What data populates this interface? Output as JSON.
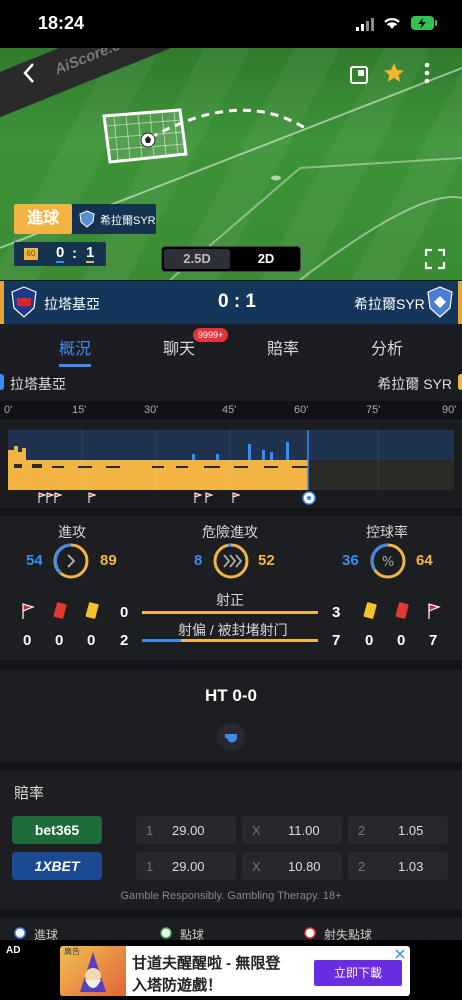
{
  "status": {
    "time": "18:24"
  },
  "pitch": {
    "brand_text": "AiScore.com",
    "event_label": "進球",
    "event_team": "希拉爾SYR",
    "live_minute": "60",
    "live_score_home": "0",
    "live_score_sep": ":",
    "live_score_away": "1",
    "view_25d": "2.5D",
    "view_2d": "2D"
  },
  "match": {
    "home_team": "拉塔基亞",
    "away_team": "希拉爾SYR",
    "score": "0 : 1"
  },
  "tabs": [
    {
      "label": "概況",
      "active": true
    },
    {
      "label": "聊天",
      "badge": "9999+"
    },
    {
      "label": "賠率"
    },
    {
      "label": "分析"
    }
  ],
  "timeline": {
    "home": "拉塔基亞",
    "away": "希拉爾 SYR",
    "ticks": [
      "0'",
      "15'",
      "30'",
      "45'",
      "60'",
      "75'",
      "90'"
    ]
  },
  "stats": {
    "attack": {
      "label": "進攻",
      "home": "54",
      "away": "89"
    },
    "danger": {
      "label": "危險進攻",
      "home": "8",
      "away": "52"
    },
    "possession": {
      "label": "控球率",
      "home": "36",
      "away": "64",
      "home_fraction": 0.36
    },
    "shots_on": {
      "label": "射正",
      "home": "0",
      "away": "3"
    },
    "shots_off": {
      "label": "射偏 / 被封堵射门",
      "home": "2",
      "away": "7"
    },
    "home_cards": {
      "corners": "0",
      "red": "0",
      "yellow": "0"
    },
    "away_cards": {
      "yellow": "0",
      "red": "0",
      "corners": "7"
    }
  },
  "halftime": {
    "text": "HT 0-0"
  },
  "odds": {
    "title": "賠率",
    "rows": [
      {
        "bookmaker": "bet365",
        "c1": "1",
        "v1": "29.00",
        "cx": "X",
        "vx": "11.00",
        "c2": "2",
        "v2": "1.05"
      },
      {
        "bookmaker": "1XBET",
        "c1": "1",
        "v1": "29.00",
        "cx": "X",
        "vx": "10.80",
        "c2": "2",
        "v2": "1.03"
      }
    ],
    "disclaimer": "Gamble Responsibly. Gambling Therapy. 18+"
  },
  "legend": [
    "進球",
    "點球",
    "射失點球"
  ],
  "ad": {
    "tag": "AD",
    "small": "廣告",
    "line1": "甘道夫醒醒啦 - 無限登",
    "line2": "入塔防遊戲！",
    "button": "立即下載"
  },
  "colors": {
    "home": "#3c8cf0",
    "away": "#f2b544",
    "accent": "#e8a53a"
  }
}
